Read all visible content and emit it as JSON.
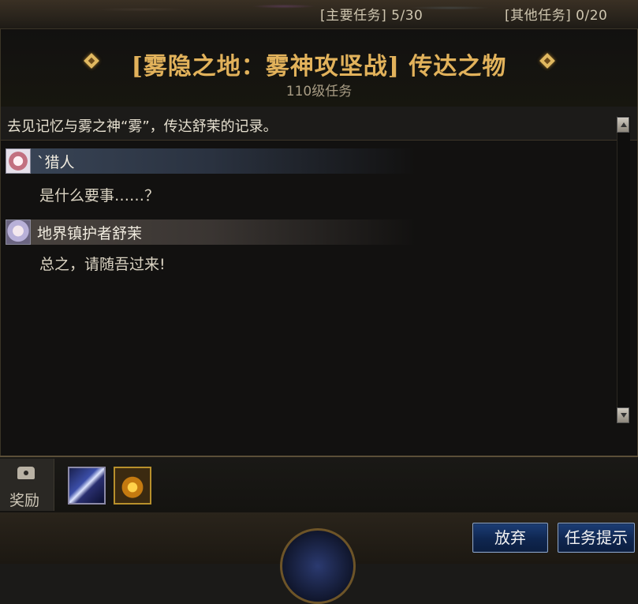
{
  "hud": {
    "main_quest_count": "[主要任务] 5/30",
    "other_quest_count": "[其他任务] 0/20"
  },
  "quest": {
    "title": "[雾隐之地：雾神攻坚战] 传达之物",
    "level": "110级任务",
    "description": "去见记忆与雾之神“雾”，传达舒茉的记录。"
  },
  "dialog": [
    {
      "speaker": "`猎人",
      "text": "是什么要事……？"
    },
    {
      "speaker": "地界镇护者舒茉",
      "text": "总之，请随吾过来!"
    }
  ],
  "reward": {
    "label": "奖励"
  },
  "buttons": {
    "abandon": "放弃",
    "hint": "任务提示"
  }
}
